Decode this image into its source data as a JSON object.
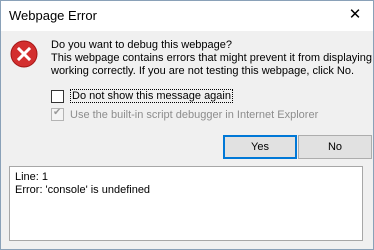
{
  "window": {
    "title": "Webpage Error",
    "close_glyph": "✕"
  },
  "message": {
    "question": "Do you want to debug this webpage?",
    "line1": "This webpage contains errors that might prevent it from displaying or",
    "line2": "working correctly. If you are not testing this webpage, click No."
  },
  "options": {
    "dont_show": {
      "label": "Do not show this message again",
      "checked": false
    },
    "use_debugger": {
      "label": "Use the built-in script debugger in Internet Explorer",
      "checked": true,
      "enabled": false
    }
  },
  "buttons": {
    "yes": "Yes",
    "no": "No"
  },
  "details": {
    "line": "Line: 1",
    "error": "Error: 'console' is undefined"
  },
  "colors": {
    "error_icon": "#d32f2f",
    "focus_border": "#0078d7"
  }
}
